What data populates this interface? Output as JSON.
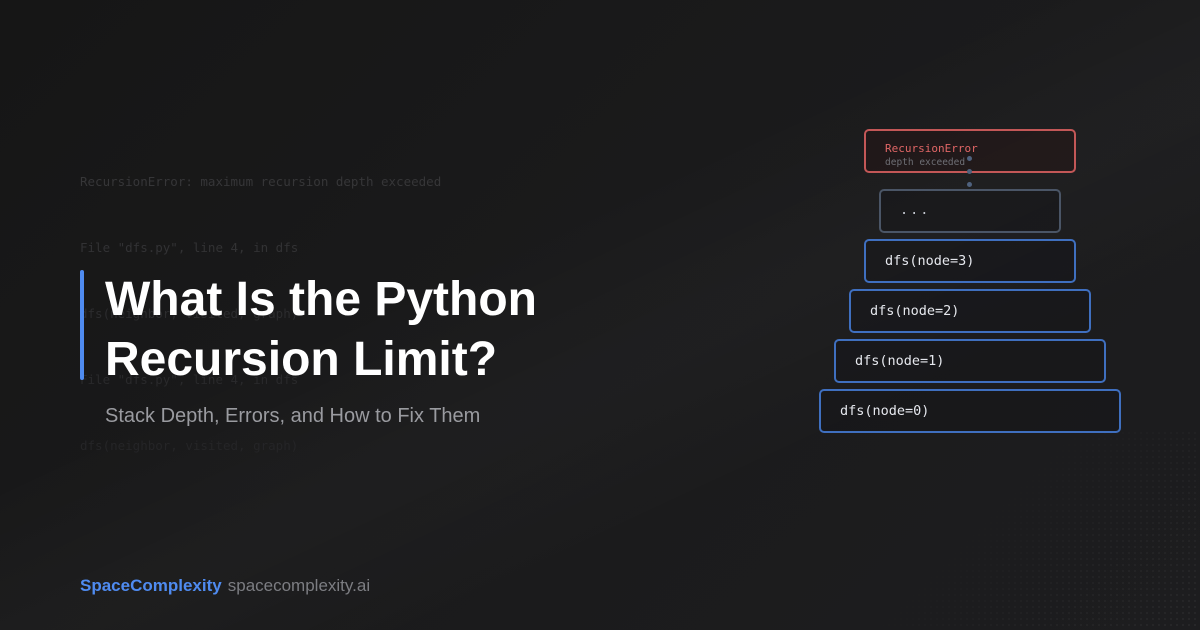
{
  "traceback": {
    "lines": [
      "RecursionError: maximum recursion depth exceeded",
      "File \"dfs.py\", line 4, in dfs",
      "dfs(neighbor, visited, graph)",
      "File \"dfs.py\", line 4, in dfs",
      "dfs(neighbor, visited, graph)"
    ]
  },
  "hero": {
    "title_line1": "What Is the Python",
    "title_line2": "Recursion Limit?",
    "subtitle": "Stack Depth, Errors, and How to Fix Them"
  },
  "footer": {
    "brand": "SpaceComplexity",
    "domain": "spacecomplexity.ai"
  },
  "call_stack": {
    "error_title": "RecursionError",
    "error_subtitle": "depth exceeded",
    "ellipsis": "...",
    "frames": [
      "dfs(node=3)",
      "dfs(node=2)",
      "dfs(node=1)",
      "dfs(node=0)"
    ]
  },
  "colors": {
    "accent": "#4f8bf0",
    "frame_border": "#3f6fbf",
    "error_border": "#c35757",
    "error_text": "#e06666",
    "background": "#1a1a1b"
  }
}
